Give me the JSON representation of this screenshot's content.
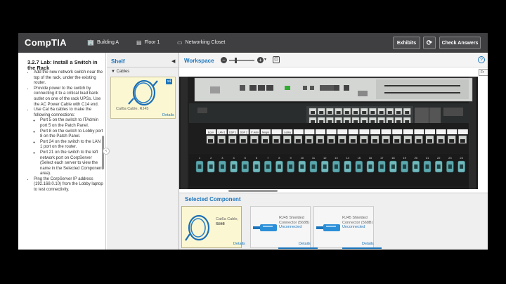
{
  "header": {
    "logo": "CompTIA",
    "breadcrumbs": [
      {
        "icon": "building-icon",
        "label": "Building A"
      },
      {
        "icon": "floor-icon",
        "label": "Floor 1"
      },
      {
        "icon": "closet-icon",
        "label": "Networking Closet"
      }
    ],
    "exhibits_label": "Exhibits",
    "reset_glyph": "⟳",
    "check_answers_label": "Check Answers"
  },
  "instructions": {
    "title": "3.2.7 Lab: Install a Switch in the Rack",
    "steps": [
      "Add the new network switch near the top of the rack, under the existing router.",
      "Provide power to the switch by connecting it to a critical load bank outlet on one of the rack UPSs. Use the AC Power Cable with C14 end.",
      "Use Cat 6a cables to make the following connections:",
      "Ping the CorpServer IP address (192.168.0.10) from the Lobby laptop to test connectivity."
    ],
    "substeps": [
      "Port 5 on the switch to ITAdmin port 5 on the Patch Panel.",
      "Port 8 on the switch to Lobby port 8 on the Patch Panel.",
      "Port 24 on the switch to the LAN 1 port on the router.",
      "Port 21 on the switch to the left network port on CorpServer (Select each server to view the name in the Selected Component area)."
    ]
  },
  "shelf": {
    "title": "Shelf",
    "category": "Cables",
    "item": {
      "label": "Cat6a Cable, RJ45",
      "badge": "x4",
      "details": "Details"
    }
  },
  "workspace": {
    "title": "Workspace",
    "front_label": "Fr",
    "rack": {
      "port_labels": [
        "Econ",
        "LAN 1",
        "DSP 1",
        "DSP 2",
        "IT Adm",
        "Mngm",
        "",
        "Lobby"
      ],
      "port_numbers": [
        "1",
        "2",
        "3",
        "4",
        "5",
        "6",
        "7",
        "8",
        "9",
        "10",
        "11",
        "12",
        "13",
        "14",
        "15",
        "16",
        "17",
        "18",
        "19",
        "20",
        "21",
        "22",
        "23",
        "24"
      ]
    }
  },
  "selected_component": {
    "title": "Selected Component",
    "cards": [
      {
        "lines": [
          "Cat6a Cable, RJ45",
          "Shelf"
        ],
        "details": "Details"
      },
      {
        "lines": [
          "RJ45 Shielded",
          "Connector (568B)",
          "Unconnected"
        ],
        "details": "Details"
      },
      {
        "lines": [
          "RJ45 Shielded",
          "Connector (568B)",
          "Unconnected"
        ],
        "details": "Details"
      }
    ]
  },
  "colors": {
    "accent": "#1b75bc",
    "header_bg": "#3f3f41",
    "shelf_card_bg": "#fbf7d2"
  }
}
